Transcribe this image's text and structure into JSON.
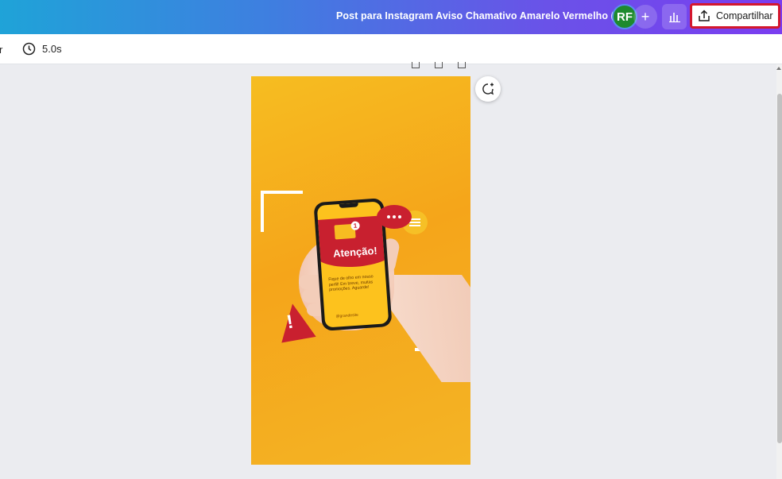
{
  "header": {
    "document_title": "Post para Instagram Aviso Chamativo Amarelo Vermelho (1...",
    "avatar_initials": "RF",
    "add_label": "+",
    "share_label": "Compartilhar"
  },
  "toolbar": {
    "cut_text": "r",
    "duration": "5.0s"
  },
  "design": {
    "headline": "Atenção!",
    "notification_count": "1",
    "body_text": "Fique de olho em nosso perfil! Em breve, muitas promoções. Aguarde!",
    "handle": "@grandesite",
    "warning_mark": "!"
  },
  "colors": {
    "share_highlight": "#d4172e",
    "avatar_bg": "#1e8a2e",
    "brand_red": "#c8202f",
    "brand_yellow": "#f6bd21"
  }
}
